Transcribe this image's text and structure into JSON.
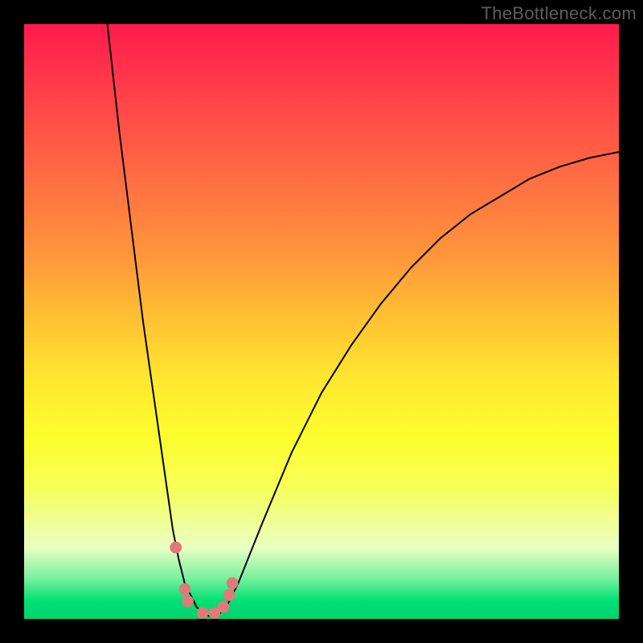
{
  "watermark": "TheBottleneck.com",
  "chart_data": {
    "type": "line",
    "title": "",
    "xlabel": "",
    "ylabel": "",
    "xlim": [
      0,
      100
    ],
    "ylim": [
      0,
      100
    ],
    "grid": false,
    "legend": false,
    "series": [
      {
        "name": "left-branch",
        "x": [
          14,
          16,
          18,
          20,
          22,
          24,
          25,
          26,
          27,
          28,
          29
        ],
        "y": [
          100,
          82,
          66,
          50,
          36,
          22,
          15,
          10,
          6,
          4,
          2
        ]
      },
      {
        "name": "valley",
        "x": [
          29,
          30,
          31,
          32,
          33,
          34
        ],
        "y": [
          2,
          1,
          0.5,
          0.5,
          1,
          2
        ]
      },
      {
        "name": "right-branch",
        "x": [
          34,
          36,
          40,
          45,
          50,
          55,
          60,
          65,
          70,
          75,
          80,
          85,
          90,
          95,
          100
        ],
        "y": [
          2,
          6,
          16,
          28,
          38,
          46,
          53,
          59,
          64,
          68,
          71,
          74,
          76,
          77.5,
          78.5
        ]
      }
    ],
    "markers": {
      "comment": "pink dots near the valley bottom",
      "points": [
        {
          "x": 25.5,
          "y": 12
        },
        {
          "x": 27.0,
          "y": 5
        },
        {
          "x": 27.5,
          "y": 3
        },
        {
          "x": 30.0,
          "y": 1
        },
        {
          "x": 32.0,
          "y": 1
        },
        {
          "x": 33.5,
          "y": 2
        },
        {
          "x": 34.5,
          "y": 4
        },
        {
          "x": 35.0,
          "y": 6
        }
      ],
      "radius_pct": 1.0
    },
    "background_gradient": {
      "top": "#ff1a4d",
      "bottom": "#00d36b"
    }
  }
}
